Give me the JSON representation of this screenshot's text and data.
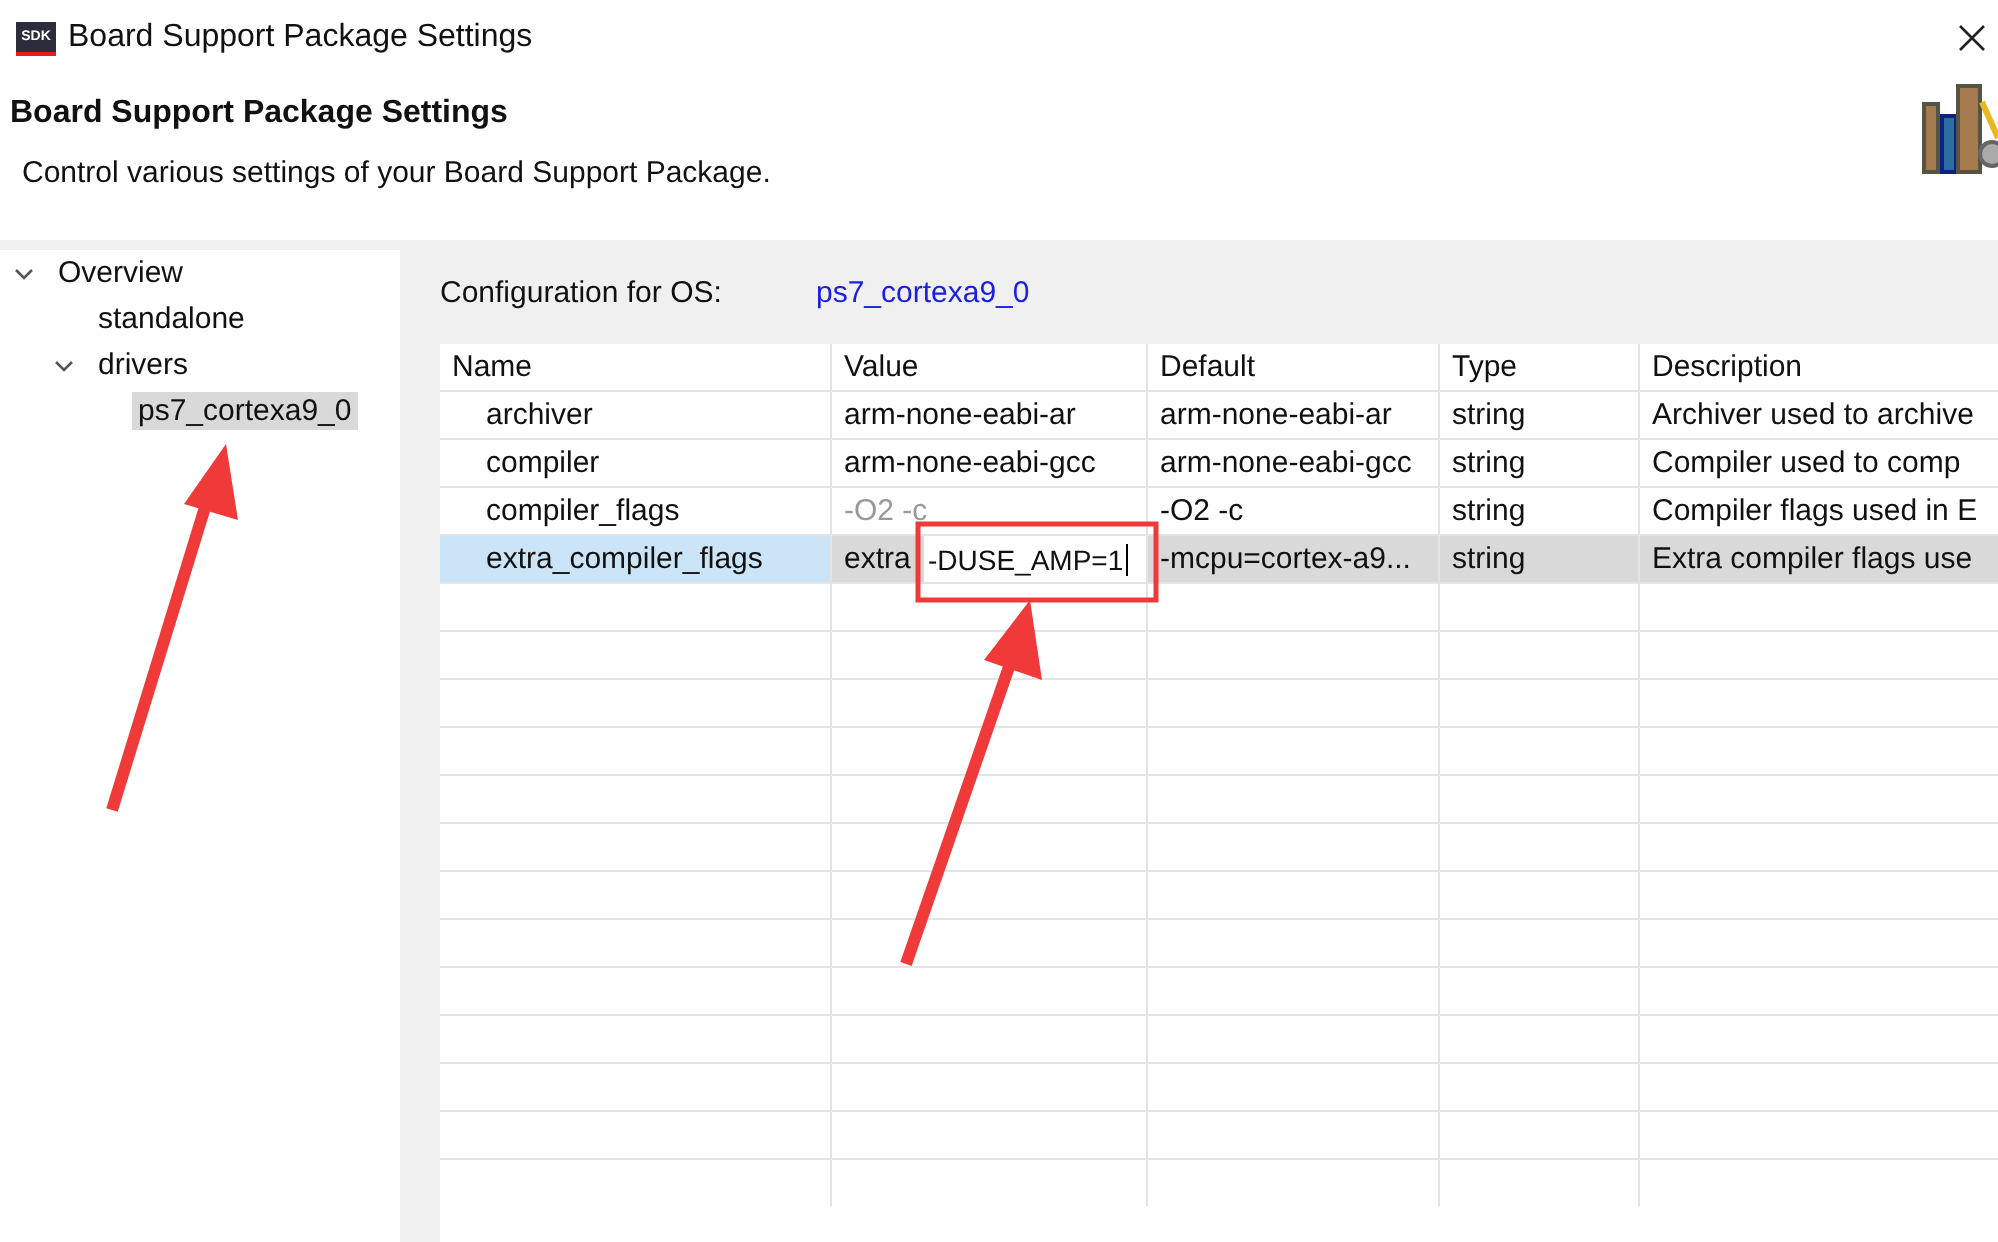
{
  "window": {
    "title": "Board Support Package Settings",
    "app_icon_text": "SDK"
  },
  "header": {
    "title": "Board Support Package Settings",
    "subtitle": "Control various settings of your Board Support Package."
  },
  "tree": [
    {
      "label": "Overview",
      "expanded": true,
      "selected": false,
      "children": [
        {
          "label": "standalone",
          "selected": false
        },
        {
          "label": "drivers",
          "expanded": true,
          "selected": false,
          "children": [
            {
              "label": "ps7_cortexa9_0",
              "selected": true
            }
          ]
        }
      ]
    }
  ],
  "config": {
    "label": "Configuration for OS:",
    "value": "ps7_cortexa9_0"
  },
  "table": {
    "columns": [
      "Name",
      "Value",
      "Default",
      "Type",
      "Description"
    ],
    "rows": [
      {
        "name": "archiver",
        "value": "arm-none-eabi-ar",
        "value_greyed": false,
        "default": "arm-none-eabi-ar",
        "type": "string",
        "description": "Archiver used to archive",
        "selected": false
      },
      {
        "name": "compiler",
        "value": "arm-none-eabi-gcc",
        "value_greyed": false,
        "default": "arm-none-eabi-gcc",
        "type": "string",
        "description": "Compiler used to comp",
        "selected": false
      },
      {
        "name": "compiler_flags",
        "value": "-O2 -c",
        "value_greyed": true,
        "default": "-O2 -c",
        "type": "string",
        "description": "Compiler flags used in E",
        "selected": false
      },
      {
        "name": "extra_compiler_flags",
        "value": "extra",
        "value_greyed": false,
        "editor_value": "-DUSE_AMP=1",
        "default": "-mcpu=cortex-a9...",
        "type": "string",
        "description": "Extra compiler flags use",
        "selected": true
      }
    ]
  }
}
